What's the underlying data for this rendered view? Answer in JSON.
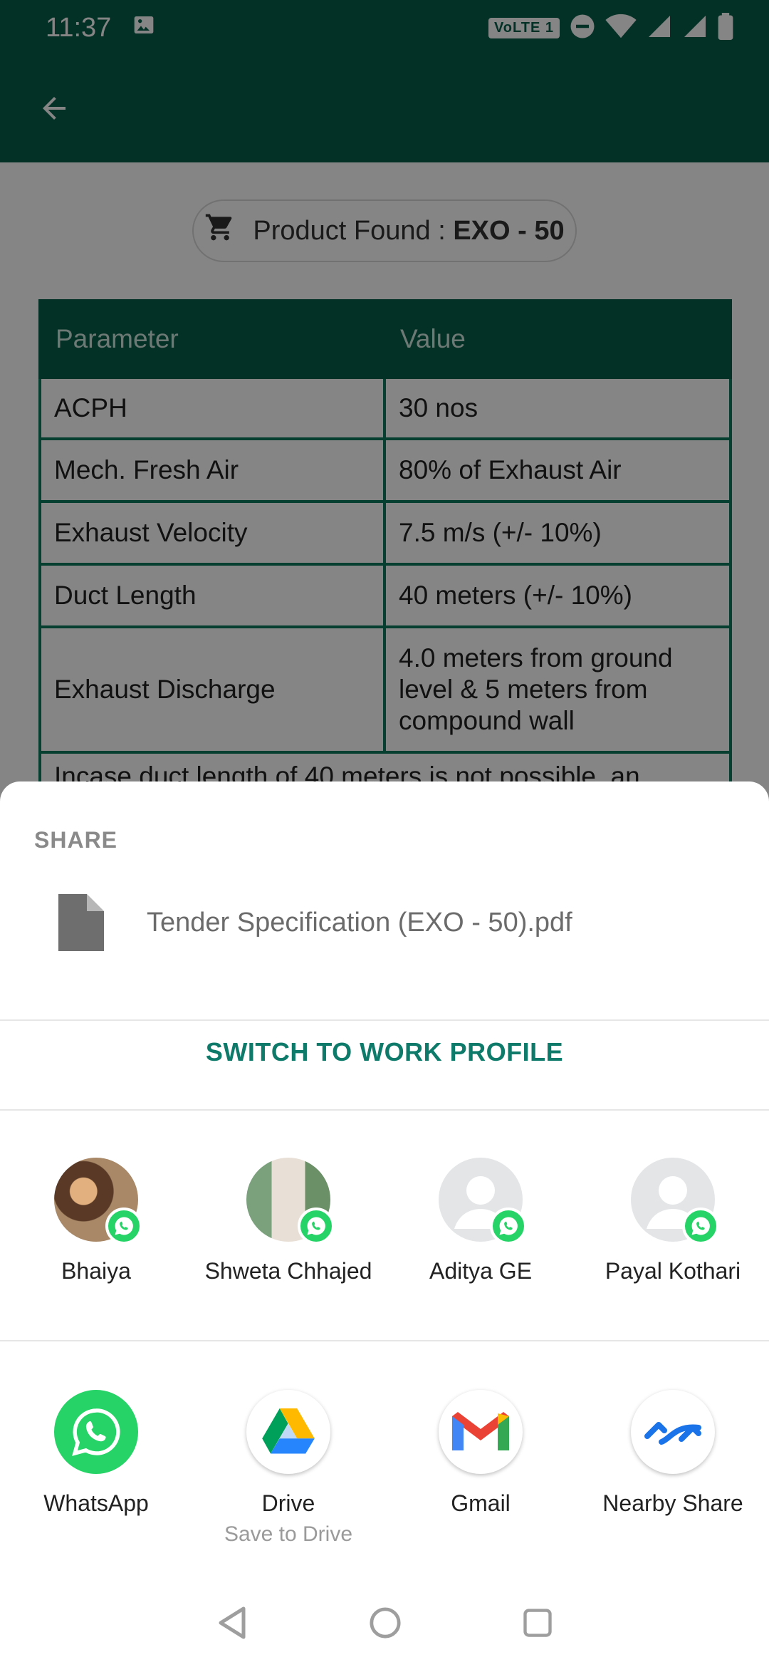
{
  "status_bar": {
    "time": "11:37",
    "network_badge": "VoLTE 1",
    "icons": [
      "image-icon",
      "do-not-disturb-icon",
      "wifi-icon",
      "signal-icon",
      "signal-icon",
      "battery-icon"
    ]
  },
  "app_bar": {
    "back_icon": "arrow-left-icon"
  },
  "product": {
    "label": "Product Found :",
    "code": "EXO - 50",
    "icon": "cart-icon"
  },
  "table": {
    "headers": [
      "Parameter",
      "Value"
    ],
    "rows": [
      {
        "parameter": "ACPH",
        "value": "30 nos"
      },
      {
        "parameter": "Mech. Fresh Air",
        "value": "80% of Exhaust Air"
      },
      {
        "parameter": "Exhaust Velocity",
        "value": "7.5 m/s (+/- 10%)"
      },
      {
        "parameter": "Duct Length",
        "value": "40 meters (+/- 10%)"
      },
      {
        "parameter": "Exhaust Discharge",
        "value": "4.0 meters from ground level & 5 meters from compound wall"
      }
    ],
    "overflow_text": "Incase duct length of 40 meters is not possible, an"
  },
  "share_sheet": {
    "title": "SHARE",
    "file_name": "Tender Specification (EXO - 50).pdf",
    "switch_profile": "SWITCH TO WORK PROFILE",
    "contacts": [
      {
        "name": "Bhaiya",
        "avatar_color": "#8a6a4f"
      },
      {
        "name": "Shweta Chhajed",
        "avatar_color": "#9fb39a"
      },
      {
        "name": "Aditya GE",
        "avatar_color": "#e3e5e7"
      },
      {
        "name": "Payal Kothari",
        "avatar_color": "#e3e5e7"
      }
    ],
    "apps": [
      {
        "name": "WhatsApp",
        "sub": "",
        "icon": "whatsapp-icon"
      },
      {
        "name": "Drive",
        "sub": "Save to Drive",
        "icon": "drive-icon"
      },
      {
        "name": "Gmail",
        "sub": "",
        "icon": "gmail-icon"
      },
      {
        "name": "Nearby Share",
        "sub": "",
        "icon": "nearby-share-icon"
      }
    ]
  },
  "colors": {
    "primary_dark": "#075e48",
    "accent": "#0d7a6a",
    "whatsapp_green": "#25d366"
  }
}
